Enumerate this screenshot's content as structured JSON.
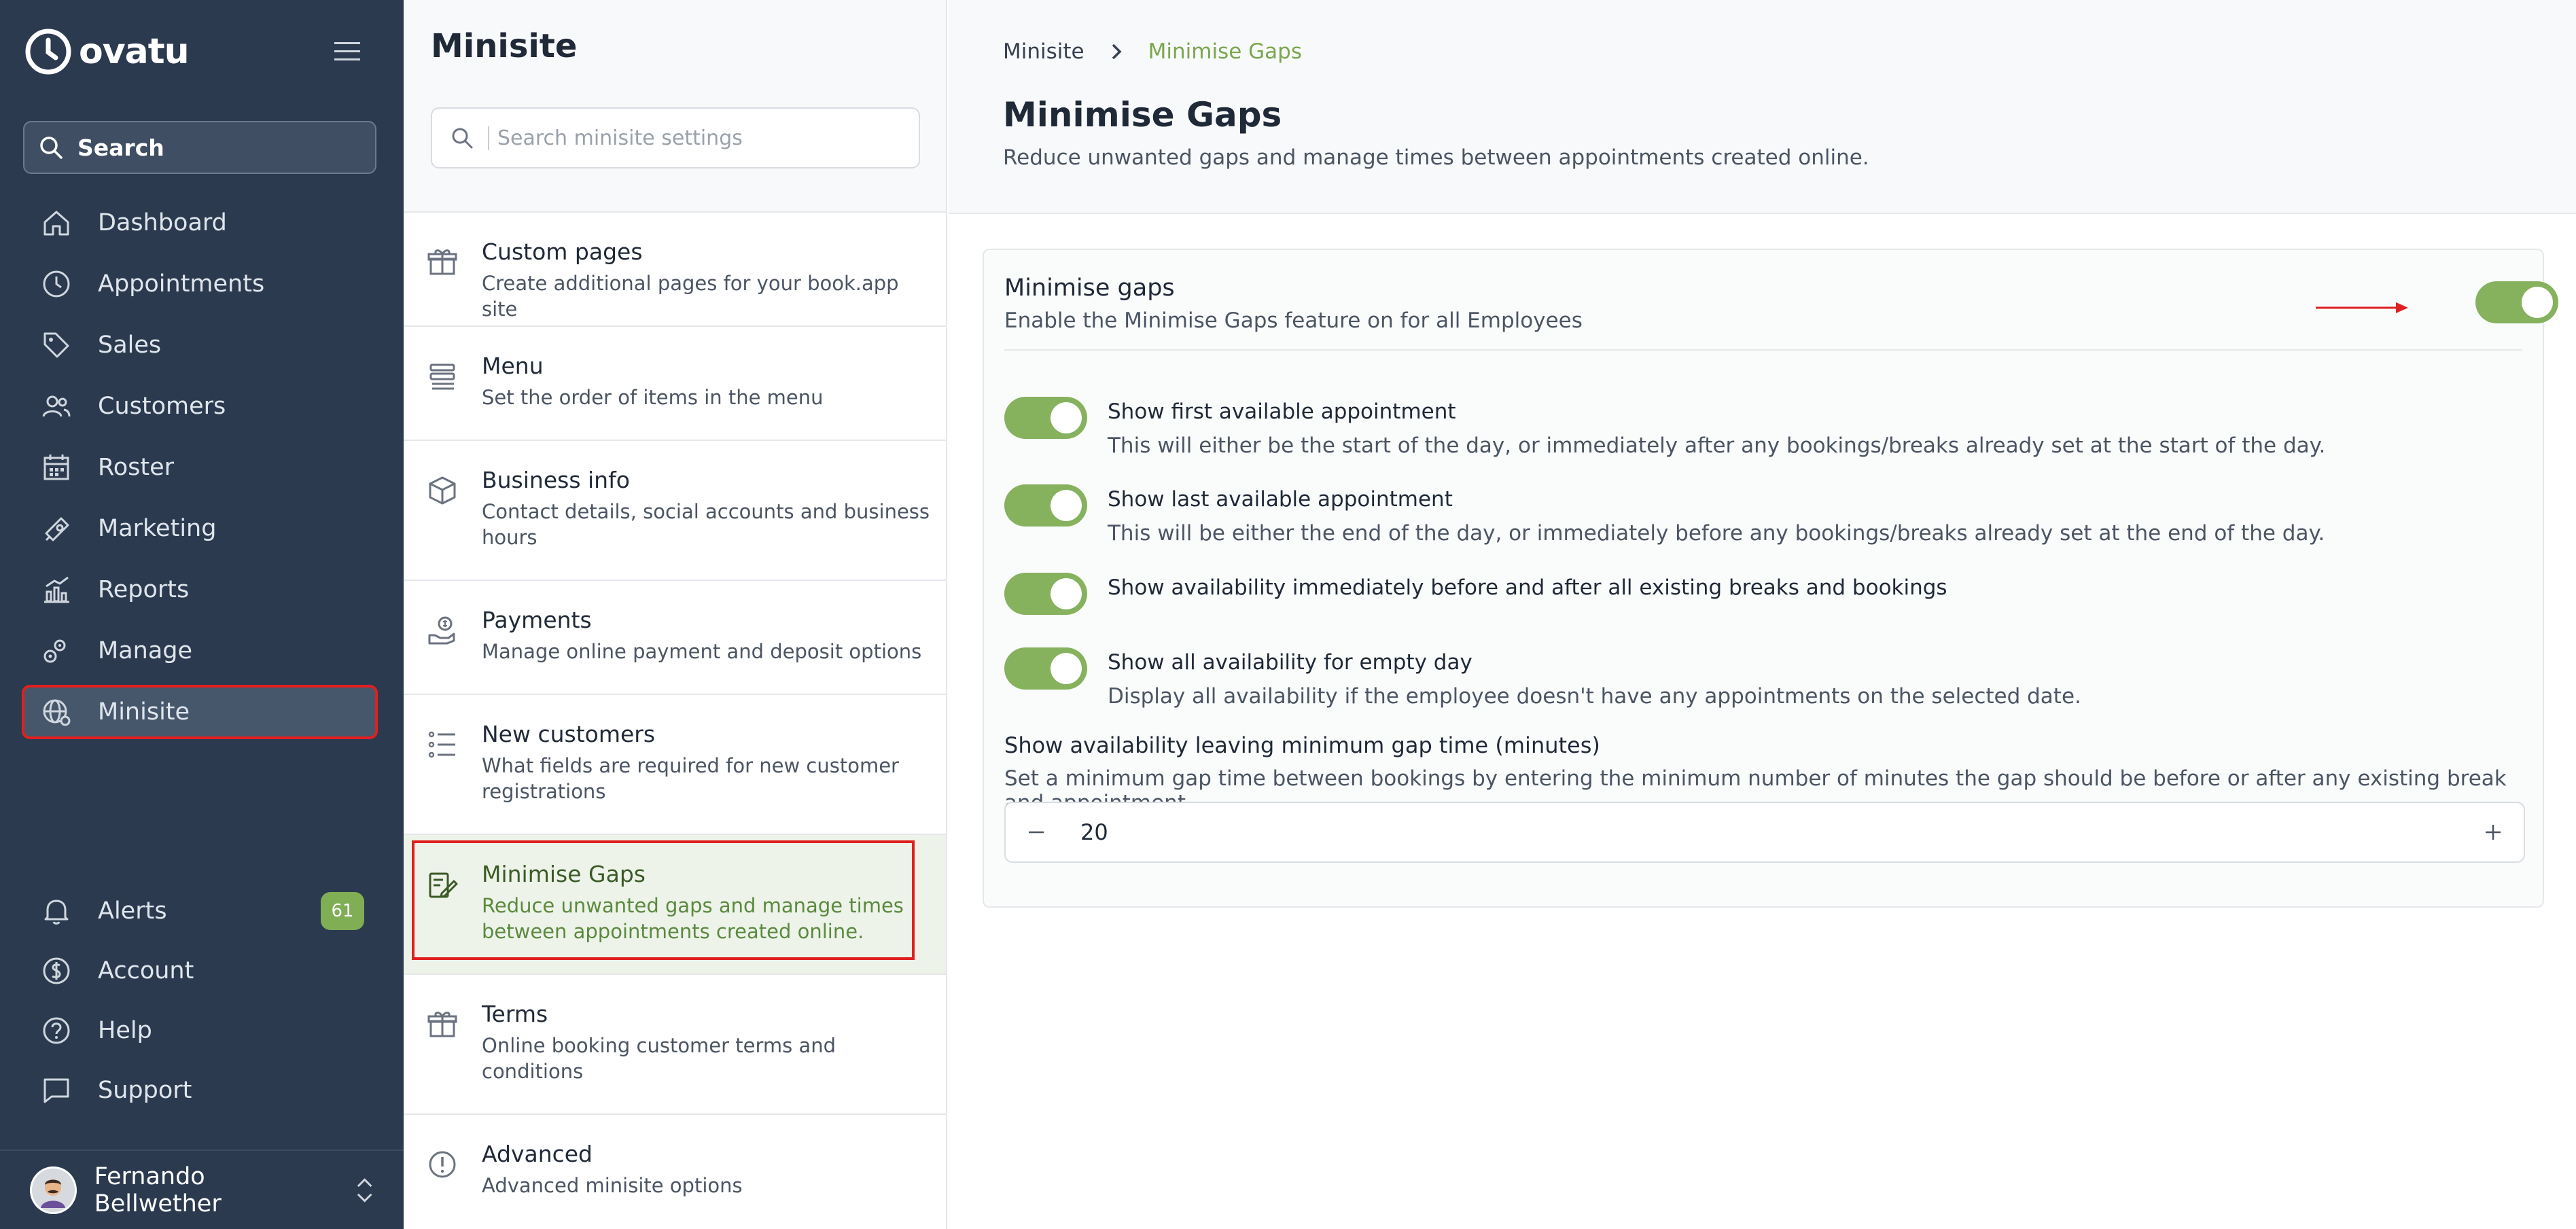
{
  "brand": {
    "name": "ovatu"
  },
  "sidebar": {
    "search_label": "Search",
    "items": [
      {
        "label": "Dashboard"
      },
      {
        "label": "Appointments"
      },
      {
        "label": "Sales"
      },
      {
        "label": "Customers"
      },
      {
        "label": "Roster"
      },
      {
        "label": "Marketing"
      },
      {
        "label": "Reports"
      },
      {
        "label": "Manage"
      },
      {
        "label": "Minisite"
      }
    ],
    "bottom": [
      {
        "label": "Alerts",
        "badge": "61"
      },
      {
        "label": "Account"
      },
      {
        "label": "Help"
      },
      {
        "label": "Support"
      }
    ],
    "user": {
      "name": "Fernando Bellwether"
    }
  },
  "settings": {
    "title": "Minisite",
    "search_placeholder": "Search minisite settings",
    "items": [
      {
        "title": "Custom pages",
        "desc": "Create additional pages for your book.app site"
      },
      {
        "title": "Menu",
        "desc": "Set the order of items in the menu"
      },
      {
        "title": "Business info",
        "desc": "Contact details, social accounts and business hours"
      },
      {
        "title": "Payments",
        "desc": "Manage online payment and deposit options"
      },
      {
        "title": "New customers",
        "desc": "What fields are required for new customer registrations"
      },
      {
        "title": "Minimise Gaps",
        "desc": "Reduce unwanted gaps and manage times between appointments created online."
      },
      {
        "title": "Terms",
        "desc": "Online booking customer terms and conditions"
      },
      {
        "title": "Advanced",
        "desc": "Advanced minisite options"
      }
    ]
  },
  "main": {
    "breadcrumb": [
      "Minisite",
      "Minimise Gaps"
    ],
    "title": "Minimise Gaps",
    "subtitle": "Reduce unwanted gaps and manage times between appointments created online.",
    "card": {
      "title": "Minimise gaps",
      "desc": "Enable the Minimise Gaps feature on for all Employees",
      "options": [
        {
          "title": "Show first available appointment",
          "desc": "This will either be the start of the day, or immediately after any bookings/breaks already set at the start of the day."
        },
        {
          "title": "Show last available appointment",
          "desc": "This will be either the end of the day, or immediately before any bookings/breaks already set at the end of the day."
        },
        {
          "title": "Show availability immediately before and after all existing breaks and bookings",
          "desc": ""
        },
        {
          "title": "Show all availability for empty day",
          "desc": "Display all availability if the employee doesn't have any appointments on the selected date."
        }
      ],
      "gap_title": "Show availability leaving minimum gap time (minutes)",
      "gap_desc": "Set a minimum gap time between bookings by entering the minimum number of minutes the gap should be before or after any existing break and appointment.",
      "gap_value": "20"
    }
  },
  "colors": {
    "sidebar": "#2b3a4f",
    "accent": "#86b25e",
    "highlight": "#e02020"
  }
}
